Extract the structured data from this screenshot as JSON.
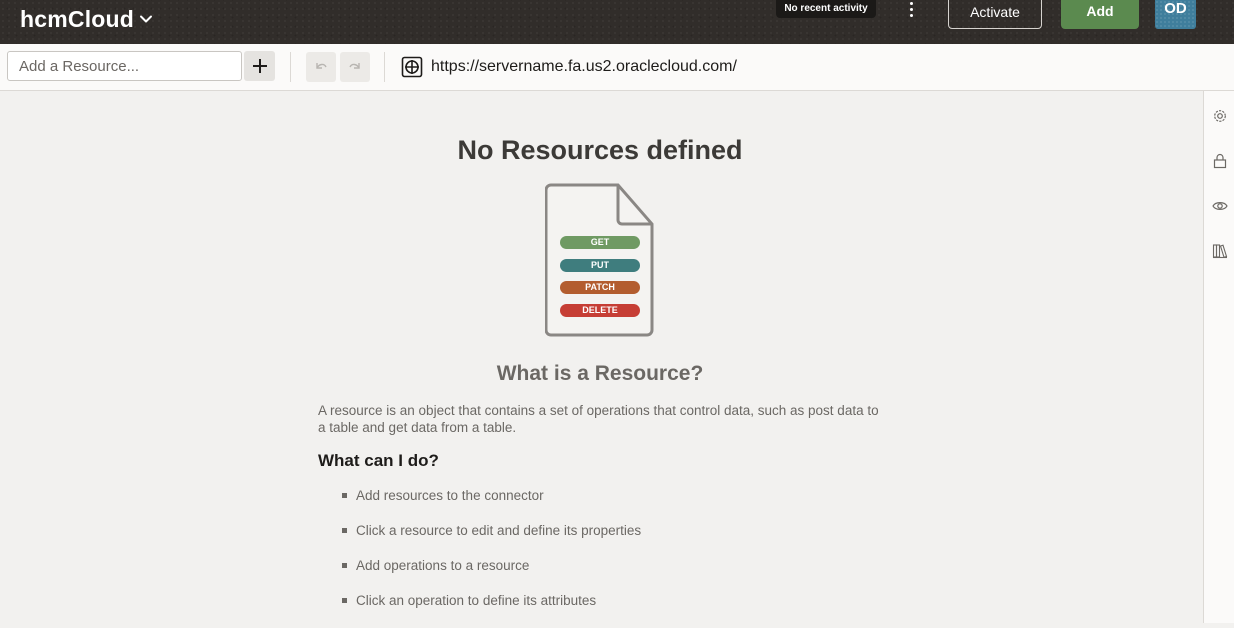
{
  "header": {
    "app_title": "hcmCloud",
    "activity_text": "No recent activity",
    "activate_label": "Activate",
    "add_label": "Add",
    "avatar_initials": "OD"
  },
  "toolbar": {
    "resource_placeholder": "Add a Resource...",
    "url": "https://servername.fa.us2.oraclecloud.com/"
  },
  "main": {
    "title": "No Resources defined",
    "methods": [
      {
        "label": "GET",
        "color": "#6f9a63"
      },
      {
        "label": "PUT",
        "color": "#3f7d7e"
      },
      {
        "label": "PATCH",
        "color": "#b35d2f"
      },
      {
        "label": "DELETE",
        "color": "#c63e35"
      }
    ],
    "subtitle": "What is a Resource?",
    "description": "A resource is an object that contains a set of operations that control data, such as post data to a table and get data from a table.",
    "what_title": "What can I do?",
    "bullets": [
      "Add resources to the connector",
      "Click a resource to edit and define its properties",
      "Add operations to a resource",
      "Click an operation to define its attributes"
    ]
  },
  "right_rail": {
    "icons": [
      "settings-icon",
      "lock-icon",
      "eye-icon",
      "library-icon"
    ]
  },
  "colors": {
    "header_bg": "#312d2a",
    "add_button": "#5b8a4f",
    "avatar": "#3f7e9c"
  }
}
